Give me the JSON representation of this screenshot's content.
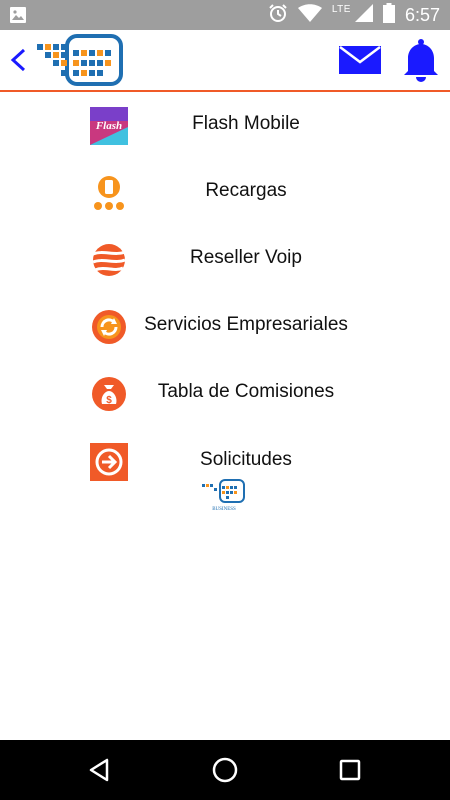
{
  "status_bar": {
    "time": "6:57",
    "network": "LTE",
    "icons": [
      "image-icon",
      "alarm-icon",
      "wifi-icon",
      "signal-icon",
      "battery-icon"
    ]
  },
  "app_bar": {
    "icons": [
      "back-arrow-icon",
      "app-logo",
      "mail-icon",
      "bell-icon"
    ],
    "accent_color": "#f05a28",
    "icon_color": "#1a1aff"
  },
  "menu": {
    "items": [
      {
        "label": "Flash Mobile",
        "icon": "flash-mobile-icon"
      },
      {
        "label": "Recargas",
        "icon": "recargas-icon"
      },
      {
        "label": "Reseller Voip",
        "icon": "reseller-voip-icon"
      },
      {
        "label": "Servicios Empresariales",
        "icon": "servicios-icon"
      },
      {
        "label": "Tabla de Comisiones",
        "icon": "money-bag-icon"
      },
      {
        "label": "Solicitudes",
        "icon": "arrow-circle-icon"
      }
    ]
  },
  "footer_logo": {
    "text": "BUSINESS"
  },
  "nav_bar": {
    "icons": [
      "nav-back-icon",
      "nav-home-icon",
      "nav-recents-icon"
    ]
  }
}
